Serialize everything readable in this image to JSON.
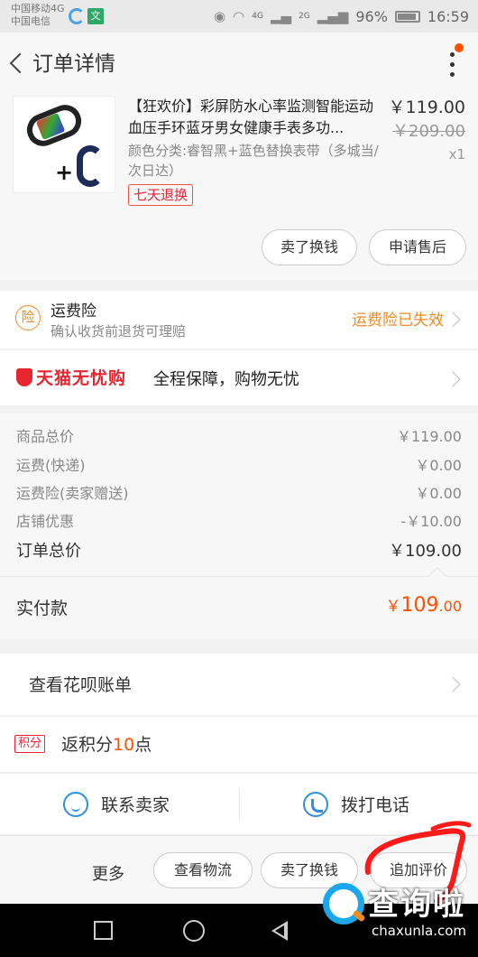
{
  "status_bar": {
    "carrier_1": "中国移动4G",
    "carrier_2": "中国电信",
    "app_badge": "文",
    "network_4g": "4G",
    "network_2g": "2G",
    "battery": "96%",
    "time": "16:59"
  },
  "header": {
    "title": "订单详情"
  },
  "product": {
    "name": "【狂欢价】彩屏防水心率监测智能运动血压手环蓝牙男女健康手表多功...",
    "sku": "颜色分类:睿智黑+蓝色替换表带（多城当/次日达）",
    "price": "￥119.00",
    "original_price": "￥209.00",
    "quantity": "x1",
    "badge": "七天退换",
    "sell_button": "卖了换钱",
    "after_sale_button": "申请售后"
  },
  "insurance": {
    "icon_char": "险",
    "title": "运费险",
    "desc": "确认收货前退货可理赔",
    "status": "运费险已失效"
  },
  "tmall": {
    "logo": "天猫无忧购",
    "slogan": "全程保障，购物无忧"
  },
  "summary": {
    "rows": [
      {
        "label": "商品总价",
        "value": "￥119.00"
      },
      {
        "label": "运费(快递)",
        "value": "￥0.00"
      },
      {
        "label": "运费险(卖家赠送)",
        "value": "￥0.00"
      },
      {
        "label": "店铺优惠",
        "value": "-￥10.00"
      }
    ],
    "total_label": "订单总价",
    "total_value": "￥109.00"
  },
  "payment": {
    "label": "实付款",
    "yen": "￥",
    "integer": "109",
    "decimal": ".00"
  },
  "huabei": {
    "label": "查看花呗账单"
  },
  "points": {
    "badge": "积分",
    "prefix": "返积分",
    "number": "10",
    "suffix": "点"
  },
  "contact": {
    "seller": "联系卖家",
    "phone": "拨打电话"
  },
  "actions": {
    "more": "更多",
    "logistics": "查看物流",
    "sell": "卖了换钱",
    "review": "追加评价"
  },
  "watermark": {
    "text": "查询啦",
    "domain": "chaxunla.com"
  },
  "colors": {
    "accent": "#ff5000",
    "insurance": "#f08a24",
    "tmall": "#e8262f",
    "icon_blue": "#2f8fe0",
    "scribble": "#ff1a1a"
  }
}
